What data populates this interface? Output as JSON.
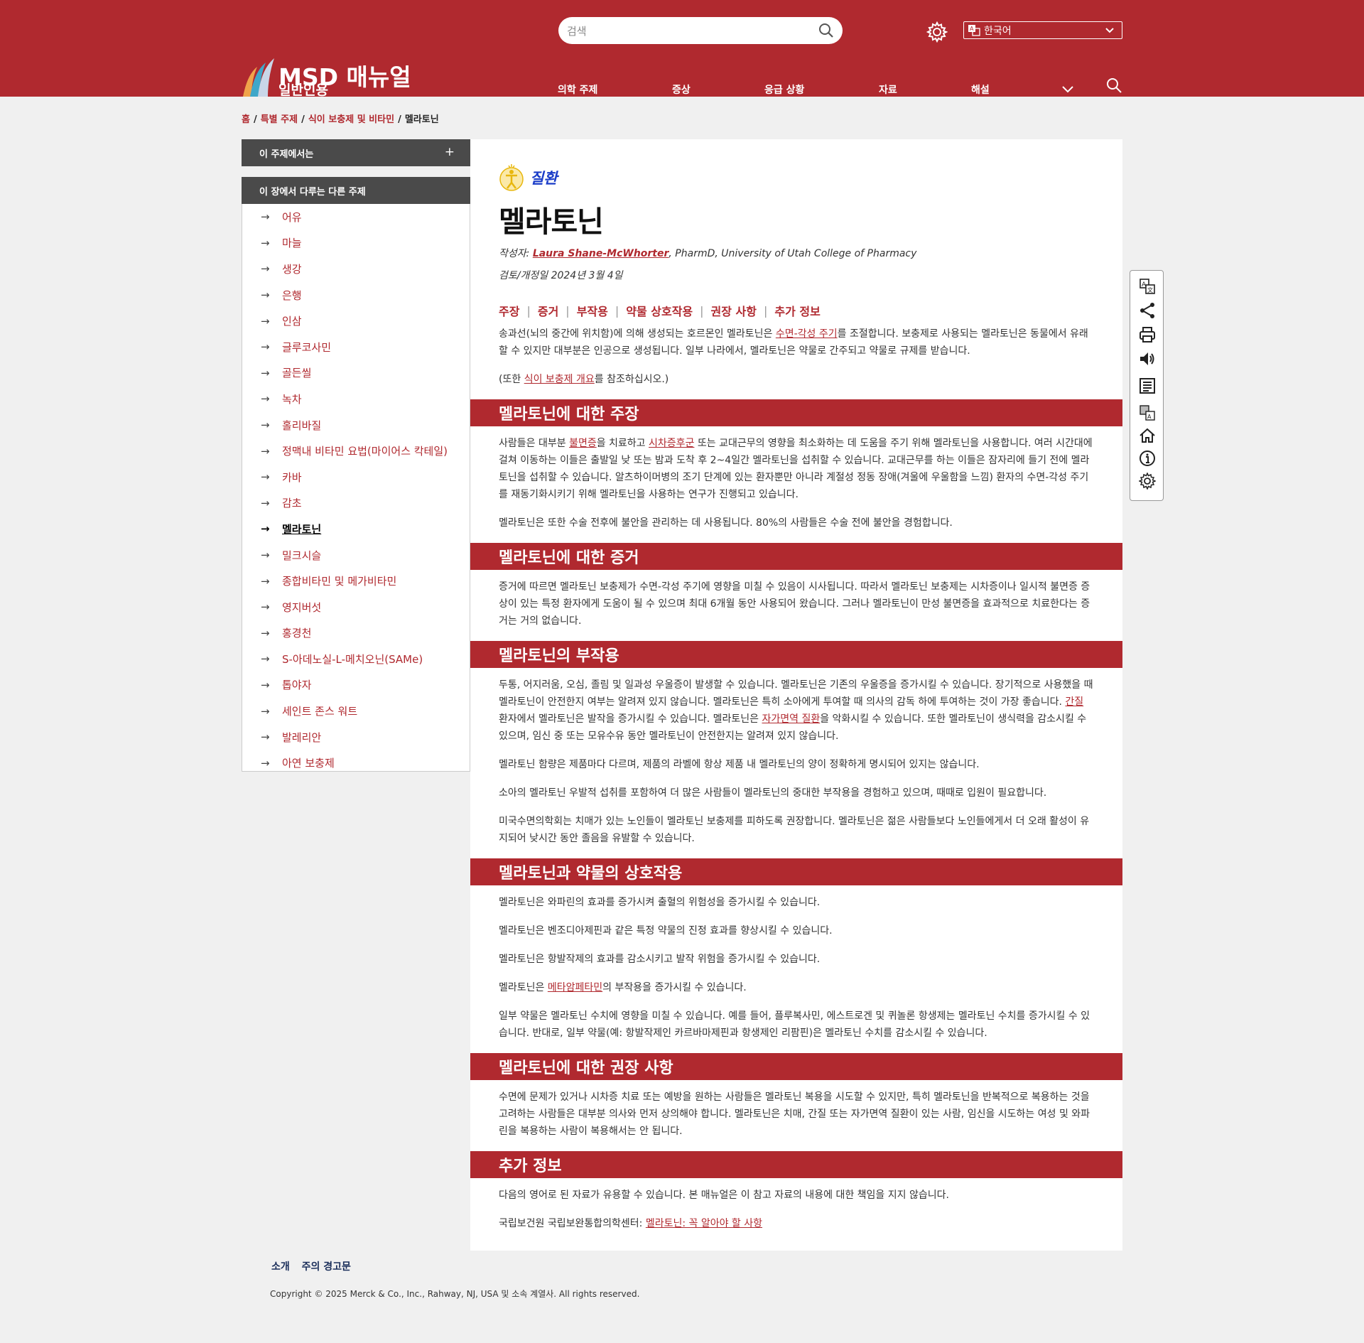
{
  "header": {
    "search_placeholder": "검색",
    "language": "한국어",
    "logo_main": "MSD 매뉴얼",
    "logo_sub": "일반인용",
    "nav": [
      "의학 주제",
      "증상",
      "응급 상황",
      "자료",
      "해설"
    ]
  },
  "breadcrumb": [
    "홈",
    "특별 주제",
    "식이 보충제 및 비타민",
    "멜라토닌"
  ],
  "sidebar": {
    "toggle_label": "이 주제에서는",
    "toggle_icon": "+",
    "section_title": "이 장에서 다루는 다른 주제",
    "items": [
      "어유",
      "마늘",
      "생강",
      "은행",
      "인삼",
      "글루코사민",
      "골든씰",
      "녹차",
      "홀리바질",
      "정맥내 비타민 요법(마이어스 칵테일)",
      "카바",
      "감초",
      "멜라토닌",
      "밀크시슬",
      "종합비타민 및 메가비타민",
      "영지버섯",
      "홍경천",
      "S-아데노실-L-메치오닌(SAMe)",
      "톱야자",
      "세인트 존스 워트",
      "발레리안",
      "아연 보충제"
    ],
    "active_index": 12
  },
  "article": {
    "category": "질환",
    "title": "멜라토닌",
    "byline_prefix": "작성자: ",
    "author": "Laura Shane-McWhorter",
    "byline_suffix": ", PharmD, University of Utah College of Pharmacy",
    "reviewed": "검토/개정일 2024년 3월 4일",
    "jump_links": [
      "주장",
      "증거",
      "부작용",
      "약물 상호작용",
      "권장 사항",
      "추가 정보"
    ],
    "intro": {
      "p1_a": "송과선(뇌의 중간에 위치함)에 의해 생성되는 호르몬인 멜라토닌은 ",
      "p1_link": "수면-각성 주기",
      "p1_b": "를 조절합니다. 보충제로 사용되는 멜라토닌은 동물에서 유래할 수 있지만 대부분은 인공으로 생성됩니다. 일부 나라에서, 멜라토닌은 약물로 간주되고 약물로 규제를 받습니다.",
      "p2_a": "(또한 ",
      "p2_link": "식이 보충제 개요",
      "p2_b": "를 참조하십시오.)"
    },
    "sec1": {
      "title": "멜라토닌에 대한 주장",
      "p1_a": "사람들은 대부분 ",
      "p1_link1": "불면증",
      "p1_b": "을 치료하고 ",
      "p1_link2": "시차증후군",
      "p1_c": " 또는 교대근무의 영향을 최소화하는 데 도움을 주기 위해 멜라토닌을 사용합니다. 여러 시간대에 걸쳐 이동하는 이들은 출발일 낮 또는 밤과 도착 후 2~4일간 멜라토닌을 섭취할 수 있습니다. 교대근무를 하는 이들은 잠자리에 들기 전에 멜라토닌을 섭취할 수 있습니다. 알츠하이머병의 조기 단계에 있는 환자뿐만 아니라 계절성 정동 장애(겨울에 우울함을 느낌) 환자의 수면-각성 주기를 재동기화시키기 위해 멜라토닌을 사용하는 연구가 진행되고 있습니다.",
      "p2": "멜라토닌은 또한 수술 전후에 불안을 관리하는 데 사용됩니다. 80%의 사람들은 수술 전에 불안을 경험합니다."
    },
    "sec2": {
      "title": "멜라토닌에 대한 증거",
      "p1": "증거에 따르면 멜라토닌 보충제가 수면-각성 주기에 영향을 미칠 수 있음이 시사됩니다. 따라서 멜라토닌 보충제는 시차증이나 일시적 불면증 증상이 있는 특정 환자에게 도움이 될 수 있으며 최대 6개월 동안 사용되어 왔습니다. 그러나 멜라토닌이 만성 불면증을 효과적으로 치료한다는 증거는 거의 없습니다."
    },
    "sec3": {
      "title": "멜라토닌의 부작용",
      "p1_a": "두통, 어지러움, 오심, 졸림 및 일과성 우울증이 발생할 수 있습니다. 멜라토닌은 기존의 우울증을 증가시킬 수 있습니다. 장기적으로 사용했을 때 멜라토닌이 안전한지 여부는 알려져 있지 않습니다. 멜라토닌은 특히 소아에게 투여할 때 의사의 감독 하에 투여하는 것이 가장 좋습니다. ",
      "p1_link1": "간질",
      "p1_b": " 환자에서 멜라토닌은 발작을 증가시킬 수 있습니다. 멜라토닌은 ",
      "p1_link2": "자가면역 질환",
      "p1_c": "을 악화시킬 수 있습니다. 또한 멜라토닌이 생식력을 감소시킬 수 있으며, 임신 중 또는 모유수유 동안 멜라토닌이 안전한지는 알려져 있지 않습니다.",
      "p2": "멜라토닌 함량은 제품마다 다르며, 제품의 라벨에 항상 제품 내 멜라토닌의 양이 정확하게 명시되어 있지는 않습니다.",
      "p3": "소아의 멜라토닌 우발적 섭취를 포함하여 더 많은 사람들이 멜라토닌의 중대한 부작용을 경험하고 있으며, 때때로 입원이 필요합니다.",
      "p4": "미국수면의학회는 치매가 있는 노인들이 멜라토닌 보충제를 피하도록 권장합니다. 멜라토닌은 젊은 사람들보다 노인들에게서 더 오래 활성이 유지되어 낮시간 동안 졸음을 유발할 수 있습니다."
    },
    "sec4": {
      "title": "멜라토닌과 약물의 상호작용",
      "p1": "멜라토닌은 와파린의 효과를 증가시켜 출혈의 위험성을 증가시킬 수 있습니다.",
      "p2": "멜라토닌은 벤조디아제핀과 같은 특정 약물의 진정 효과를 향상시킬 수 있습니다.",
      "p3": "멜라토닌은 항발작제의 효과를 감소시키고 발작 위험을 증가시킬 수 있습니다.",
      "p4_a": "멜라토닌은 ",
      "p4_link": "메타암페타민",
      "p4_b": "의 부작용을 증가시킬 수 있습니다.",
      "p5": "일부 약물은 멜라토닌 수치에 영향을 미칠 수 있습니다. 예를 들어, 플루복사민, 에스트로겐 및 퀴놀론 항생제는 멜라토닌 수치를 증가시킬 수 있습니다. 반대로, 일부 약물(예: 항발작제인 카르바마제핀과 항생제인 리팜핀)은 멜라토닌 수치를 감소시킬 수 있습니다."
    },
    "sec5": {
      "title": "멜라토닌에 대한 권장 사항",
      "p1": "수면에 문제가 있거나 시차증 치료 또는 예방을 원하는 사람들은 멜라토닌 복용을 시도할 수 있지만, 특히 멜라토닌을 반복적으로 복용하는 것을 고려하는 사람들은 대부분 의사와 먼저 상의해야 합니다. 멜라토닌은 치매, 간질 또는 자가면역 질환이 있는 사람, 임신을 시도하는 여성 및 와파린을 복용하는 사람이 복용해서는 안 됩니다."
    },
    "sec6": {
      "title": "추가 정보",
      "p1": "다음의 영어로 된 자료가 유용할 수 있습니다. 본 매뉴얼은 이 참고 자료의 내용에 대한 책임을 지지 않습니다.",
      "p2_a": "국립보건원 국립보완통합의학센터: ",
      "p2_link": "멜라토닌: 꼭 알아야 할 사항"
    }
  },
  "tool_rail_icons": [
    "translate-icon",
    "share-icon",
    "print-icon",
    "audio-icon",
    "outline-icon",
    "translate-alt-icon",
    "home-icon",
    "info-icon",
    "settings-icon"
  ],
  "footer": {
    "links": [
      "소개",
      "주의 경고문"
    ],
    "copyright": "Copyright  © 2025  Merck & Co., Inc., Rahway, NJ, USA 및 소속 계열사. All rights reserved."
  },
  "colors": {
    "brand": "#b0292f",
    "panel_dark": "#4a4a4a",
    "category_blue": "#1a3cc8"
  }
}
